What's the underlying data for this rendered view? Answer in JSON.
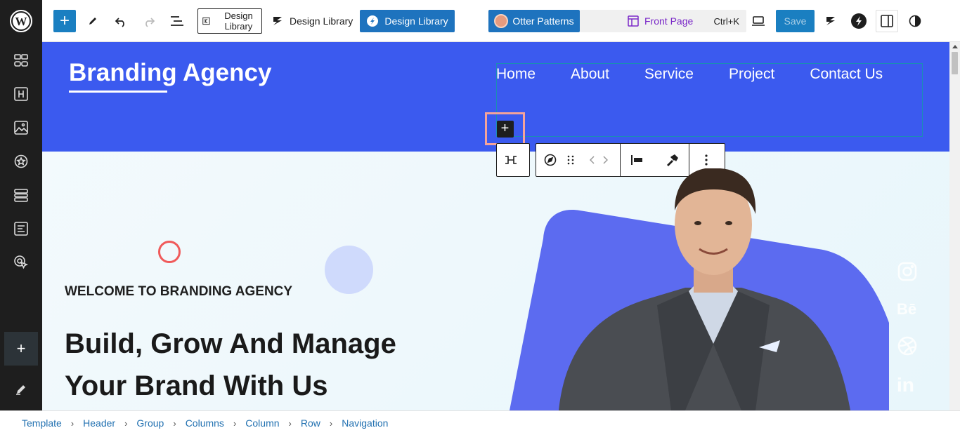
{
  "toolbar": {
    "design_library_outline": "Design Library",
    "design_library_plain": "Design Library",
    "design_library_blue": "Design Library",
    "otter_patterns": "Otter Patterns",
    "command_page": "Front Page",
    "command_shortcut": "Ctrl+K",
    "save_label": "Save"
  },
  "header": {
    "brand": "Branding Agency",
    "nav": [
      "Home",
      "About",
      "Service",
      "Project",
      "Contact Us"
    ]
  },
  "hero": {
    "welcome": "WELCOME TO BRANDING AGENCY",
    "headline_line1": "Build, Grow And Manage",
    "headline_line2": "Your Brand With Us"
  },
  "social": [
    "instagram-icon",
    "behance-icon",
    "dribbble-icon",
    "linkedin-icon"
  ],
  "breadcrumb": [
    "Template",
    "Header",
    "Group",
    "Columns",
    "Column",
    "Row",
    "Navigation"
  ],
  "colors": {
    "header_bg": "#3b5aef",
    "primary_button": "#1a7fc1",
    "accent_purple": "#7a28c8",
    "breadcrumb_link": "#2271b1"
  }
}
